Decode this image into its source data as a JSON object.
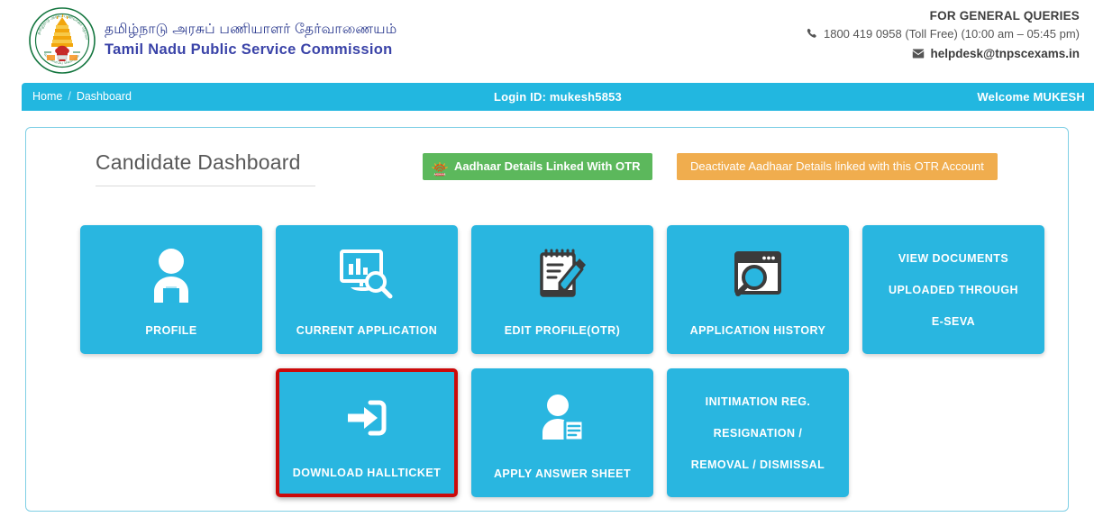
{
  "header": {
    "logo_icon": "tnpsc-emblem-icon",
    "brand_tamil": "தமிழ்நாடு அரசுப் பணியாளர் தேர்வாணையம்",
    "brand_english": "Tamil Nadu Public Service Commission",
    "queries_title": "FOR GENERAL QUERIES",
    "phone_icon": "phone-icon",
    "phone": "1800 419 0958 (Toll Free)  (10:00 am – 05:45 pm)",
    "mail_icon": "envelope-icon",
    "email": "helpdesk@tnpscexams.in"
  },
  "navbar": {
    "home": "Home",
    "separator": "/",
    "dashboard": "Dashboard",
    "login_id": "Login ID: mukesh5853",
    "welcome": "Welcome MUKESH",
    "bg_color": "#22b7e0"
  },
  "content": {
    "page_title": "Candidate Dashboard",
    "aadhaar_button": {
      "label": "Aadhaar Details Linked With OTR",
      "icon": "aadhaar-logo-icon",
      "color": "#5cb85c"
    },
    "deactivate_button": {
      "label": "Deactivate Aadhaar Details linked with this OTR Account",
      "color": "#f0ad4e"
    },
    "tile_color": "#29b6e0",
    "highlight_color": "#cc0a0a",
    "tiles_row1": [
      {
        "label": "PROFILE",
        "icon": "user-profile-icon"
      },
      {
        "label": "CURRENT APPLICATION",
        "icon": "monitor-chart-search-icon"
      },
      {
        "label": "EDIT PROFILE(OTR)",
        "icon": "notepad-pencil-icon"
      },
      {
        "label": "APPLICATION HISTORY",
        "icon": "browser-window-search-icon"
      },
      {
        "label_lines": [
          "VIEW DOCUMENTS",
          "UPLOADED THROUGH",
          "E-SEVA"
        ],
        "icon": ""
      }
    ],
    "tiles_row2": [
      {
        "label": "DOWNLOAD HALLTICKET",
        "icon": "login-arrow-icon",
        "highlighted": true
      },
      {
        "label": "APPLY ANSWER SHEET",
        "icon": "user-document-icon"
      },
      {
        "label_lines": [
          "INITIMATION REG.",
          "RESIGNATION /",
          "REMOVAL / DISMISSAL"
        ],
        "icon": ""
      }
    ]
  }
}
